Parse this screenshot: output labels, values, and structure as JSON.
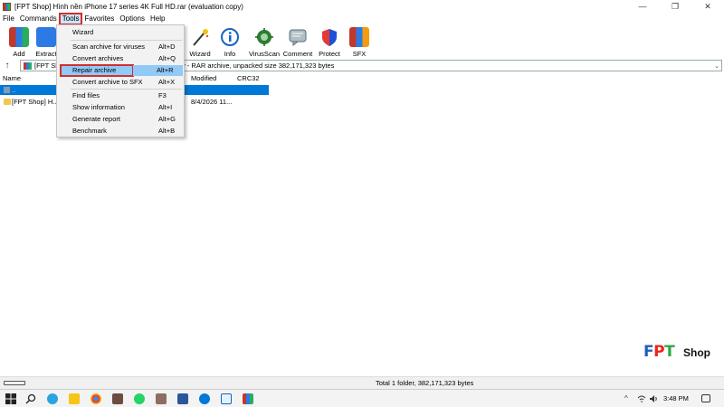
{
  "window": {
    "title": "[FPT Shop] Hình nền iPhone 17 series 4K Full HD.rar (evaluation copy)",
    "minimize": "—",
    "maximize": "❐",
    "close": "✕"
  },
  "menubar": {
    "items": [
      "File",
      "Commands",
      "Tools",
      "Favorites",
      "Options",
      "Help"
    ],
    "active": "Tools"
  },
  "toolbar": {
    "buttons": [
      {
        "label": "Add",
        "icon": "add-icon",
        "color": "#e53935"
      },
      {
        "label": "Extract",
        "icon": "extract-icon",
        "color": "#1e88e5"
      },
      {
        "label": "Wizard",
        "icon": "wizard-icon",
        "color": "#6d4c41"
      },
      {
        "label": "Info",
        "icon": "info-icon",
        "color": "#1565c0"
      },
      {
        "label": "VirusScan",
        "icon": "virusscan-icon",
        "color": "#2e7d32"
      },
      {
        "label": "Comment",
        "icon": "comment-icon",
        "color": "#78909c"
      },
      {
        "label": "Protect",
        "icon": "protect-icon",
        "color": "#1e4fd8"
      },
      {
        "label": "SFX",
        "icon": "sfx-icon",
        "color": "#f39c12"
      }
    ]
  },
  "address": {
    "path_prefix": "[FPT Sh",
    "path_suffix": "y - RAR archive, unpacked size 382,171,323 bytes"
  },
  "list": {
    "columns": [
      "Name",
      "Modified",
      "CRC32"
    ],
    "rows": [
      {
        "name": "..",
        "modified": ""
      },
      {
        "name": "[FPT Shop] H...",
        "modified": "8/4/2026 11..."
      }
    ]
  },
  "tools_menu": {
    "items": [
      {
        "label": "Wizard",
        "key": ""
      },
      {
        "label": "Scan archive for viruses",
        "key": "Alt+D"
      },
      {
        "label": "Convert archives",
        "key": "Alt+Q"
      },
      {
        "label": "Repair archive",
        "key": "Alt+R",
        "highlighted": true
      },
      {
        "label": "Convert archive to SFX",
        "key": "Alt+X"
      },
      {
        "label": "Find files",
        "key": "F3"
      },
      {
        "label": "Show information",
        "key": "Alt+I"
      },
      {
        "label": "Generate report",
        "key": "Alt+G"
      },
      {
        "label": "Benchmark",
        "key": "Alt+B"
      }
    ]
  },
  "status": {
    "text": "Total 1 folder, 382,171,323 bytes"
  },
  "logo": {
    "brand": "FPT",
    "suffix": "Shop",
    "colors": [
      "#1f5fb4",
      "#e8261b",
      "#2ea645"
    ]
  },
  "taskbar": {
    "time": "3:48 PM"
  }
}
